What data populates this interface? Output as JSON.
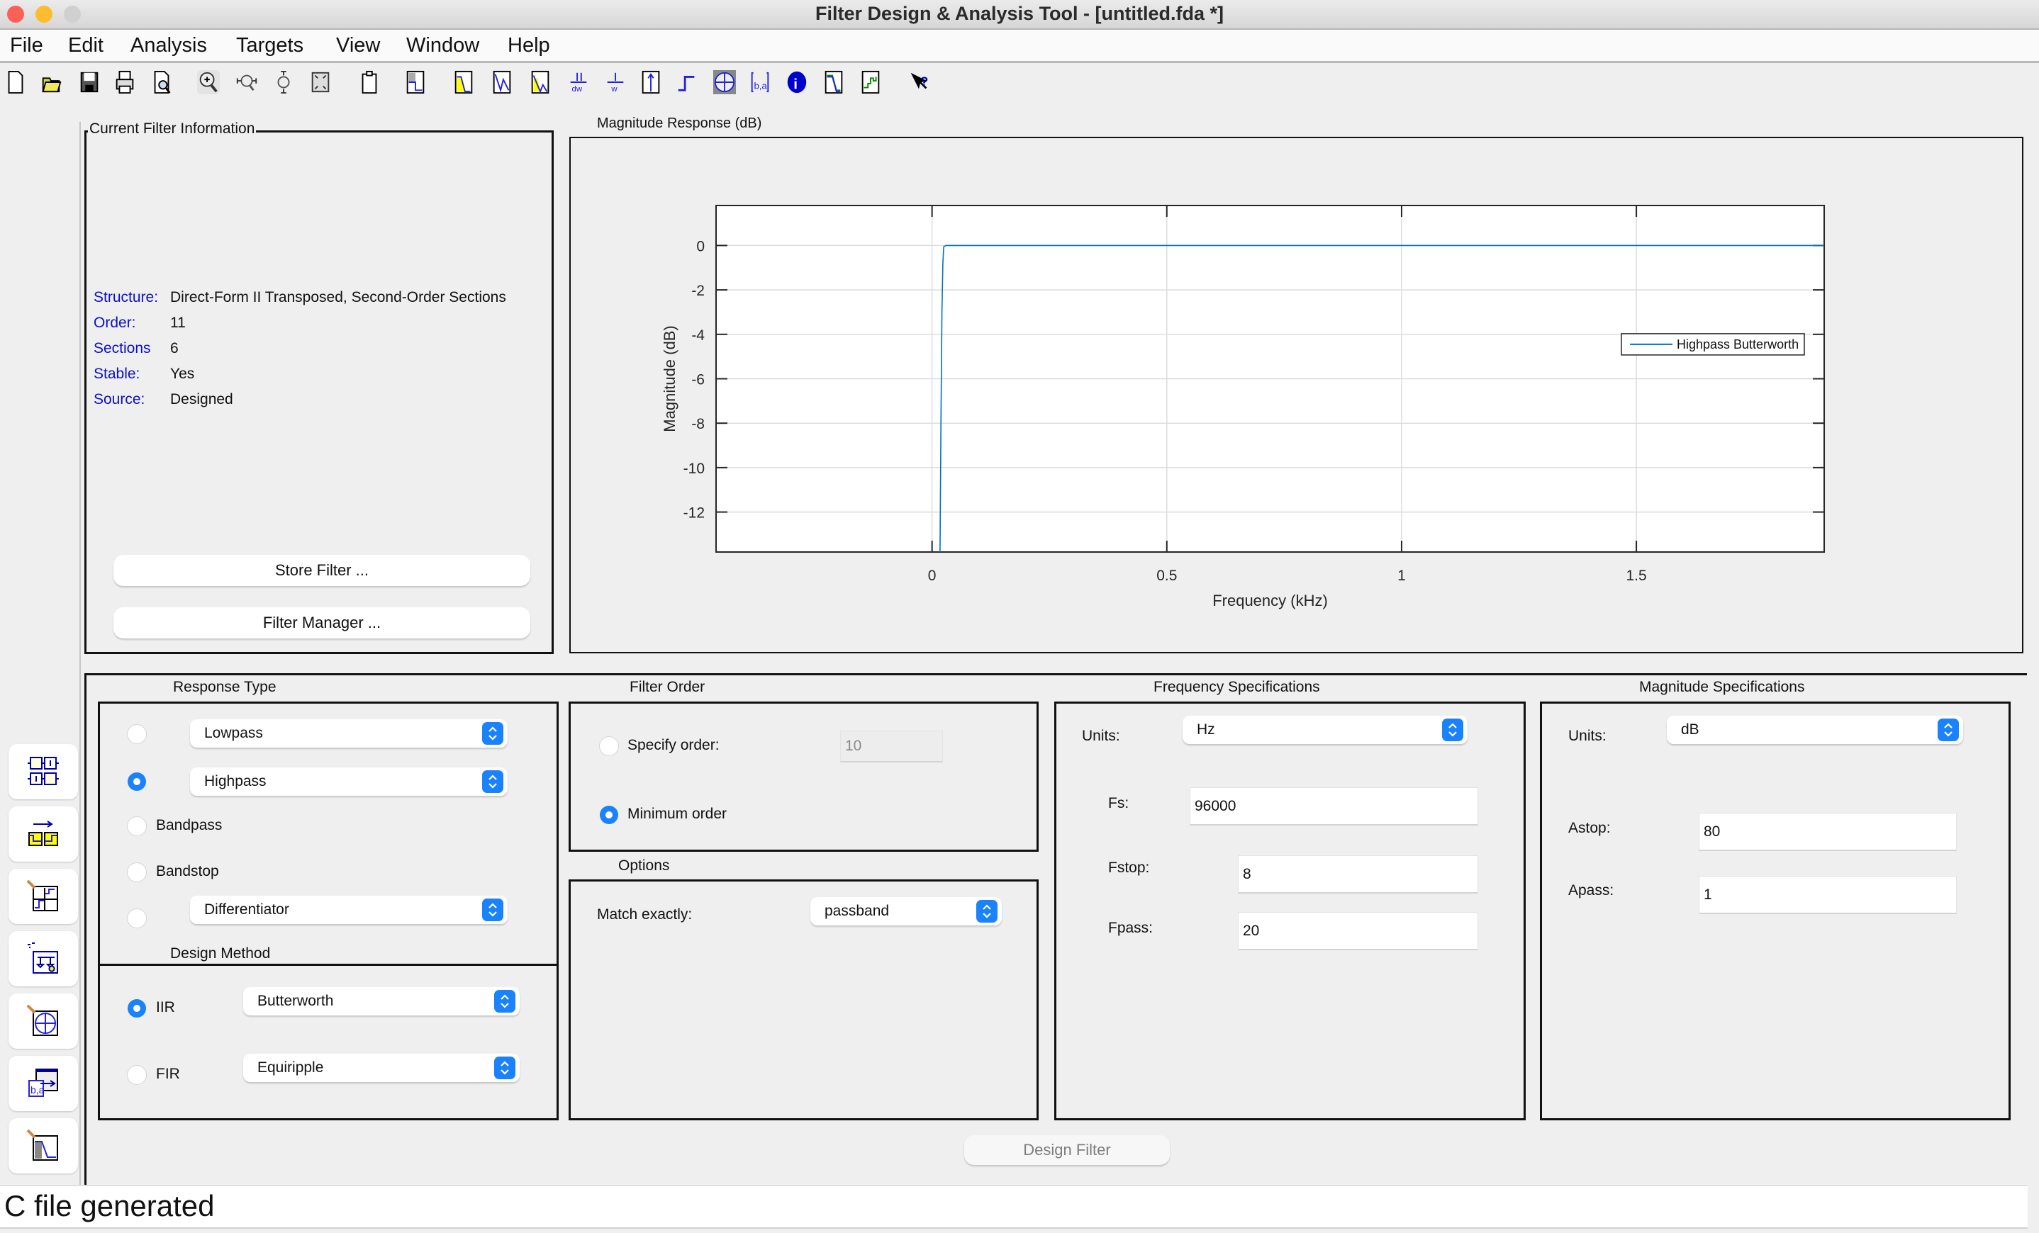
{
  "window": {
    "title": "Filter Design & Analysis Tool -  [untitled.fda *]",
    "traffic_lights": [
      "close",
      "minimize",
      "zoom"
    ]
  },
  "menu": [
    "File",
    "Edit",
    "Analysis",
    "Targets",
    "View",
    "Window",
    "Help"
  ],
  "toolbar": [
    {
      "icon": "new-file-icon"
    },
    {
      "icon": "open-folder-icon"
    },
    {
      "icon": "save-icon"
    },
    {
      "icon": "print-icon"
    },
    {
      "icon": "print-preview-icon"
    },
    {
      "icon": "zoom-in-icon"
    },
    {
      "icon": "zoom-x-icon"
    },
    {
      "icon": "zoom-y-icon"
    },
    {
      "icon": "full-view-icon"
    },
    {
      "icon": "new-figure-icon"
    },
    {
      "icon": "filter-specifications-icon"
    },
    {
      "icon": "magnitude-response-icon"
    },
    {
      "icon": "phase-response-icon"
    },
    {
      "icon": "magnitude-phase-response-icon"
    },
    {
      "icon": "group-delay-icon"
    },
    {
      "icon": "phase-delay-icon"
    },
    {
      "icon": "impulse-response-icon"
    },
    {
      "icon": "step-response-icon"
    },
    {
      "icon": "pole-zero-plot-icon"
    },
    {
      "icon": "filter-coefficients-icon"
    },
    {
      "icon": "filter-information-icon"
    },
    {
      "icon": "magnitude-response-estimate-icon"
    },
    {
      "icon": "round-off-noise-icon"
    },
    {
      "icon": "whats-this-help-icon"
    }
  ],
  "sidebar": [
    {
      "icon": "transform-filter-icon"
    },
    {
      "icon": "convert-structure-icon"
    },
    {
      "icon": "set-quantization-icon"
    },
    {
      "icon": "realize-model-icon"
    },
    {
      "icon": "pole-zero-editor-icon"
    },
    {
      "icon": "import-filter-icon"
    },
    {
      "icon": "design-filter-icon"
    }
  ],
  "current_filter_info": {
    "title": "Current Filter Information",
    "rows": [
      {
        "label": "Structure:",
        "value": "Direct-Form II Transposed, Second-Order Sections"
      },
      {
        "label": "Order:",
        "value": "11"
      },
      {
        "label": "Sections",
        "value": "6"
      },
      {
        "label": "Stable:",
        "value": "Yes"
      },
      {
        "label": "Source:",
        "value": "Designed"
      }
    ],
    "store_filter_label": "Store Filter ...",
    "filter_manager_label": "Filter Manager ..."
  },
  "magnitude_panel": {
    "title": "Magnitude Response (dB)"
  },
  "chart_data": {
    "type": "line",
    "title": "Magnitude Response (dB)",
    "xlabel": "Frequency (kHz)",
    "ylabel": "Magnitude (dB)",
    "xlim": [
      -0.46,
      1.9
    ],
    "ylim": [
      -13.8,
      1.8
    ],
    "xticks": [
      0,
      0.5,
      1,
      1.5
    ],
    "xtick_labels": [
      "0",
      "0.5",
      "1",
      "1.5"
    ],
    "yticks": [
      0,
      -2,
      -4,
      -6,
      -8,
      -10,
      -12
    ],
    "ytick_labels": [
      "0",
      "-2",
      "-4",
      "-6",
      "-8",
      "-10",
      "-12"
    ],
    "grid": true,
    "legend": {
      "entries": [
        "Highpass Butterworth"
      ],
      "placement": "right"
    },
    "series": [
      {
        "name": "Highpass Butterworth",
        "color": "#0072bd",
        "x": [
          0.017,
          0.019,
          0.021,
          0.023,
          0.025,
          0.03,
          0.5,
          1.0,
          1.5,
          1.9
        ],
        "y": [
          -14.0,
          -8.0,
          -3.0,
          -0.8,
          -0.05,
          0,
          0,
          0,
          0,
          0
        ]
      }
    ]
  },
  "response_type": {
    "title": "Response Type",
    "options": [
      {
        "kind": "select",
        "value": "Lowpass",
        "selected": false
      },
      {
        "kind": "select",
        "value": "Highpass",
        "selected": true
      },
      {
        "kind": "label",
        "value": "Bandpass",
        "selected": false
      },
      {
        "kind": "label",
        "value": "Bandstop",
        "selected": false
      },
      {
        "kind": "select",
        "value": "Differentiator",
        "selected": false
      }
    ]
  },
  "design_method": {
    "title": "Design Method",
    "options": [
      {
        "label": "IIR",
        "select": "Butterworth",
        "selected": true
      },
      {
        "label": "FIR",
        "select": "Equiripple",
        "selected": false
      }
    ]
  },
  "filter_order": {
    "title": "Filter Order",
    "specify_label": "Specify order:",
    "specify_value": "10",
    "specify_selected": false,
    "minimum_label": "Minimum order",
    "minimum_selected": true
  },
  "options": {
    "title": "Options",
    "match_label": "Match exactly:",
    "match_value": "passband"
  },
  "frequency_specs": {
    "title": "Frequency Specifications",
    "units_label": "Units:",
    "units_value": "Hz",
    "fs_label": "Fs:",
    "fs_value": "96000",
    "fstop_label": "Fstop:",
    "fstop_value": "8",
    "fpass_label": "Fpass:",
    "fpass_value": "20"
  },
  "magnitude_specs": {
    "title": "Magnitude Specifications",
    "units_label": "Units:",
    "units_value": "dB",
    "astop_label": "Astop:",
    "astop_value": "80",
    "apass_label": "Apass:",
    "apass_value": "1"
  },
  "design_filter_label": "Design Filter",
  "status": "C file generated",
  "colors": {
    "accent": "#1a82fb",
    "info_label": "#0b10cc",
    "series": "#0072bd"
  }
}
